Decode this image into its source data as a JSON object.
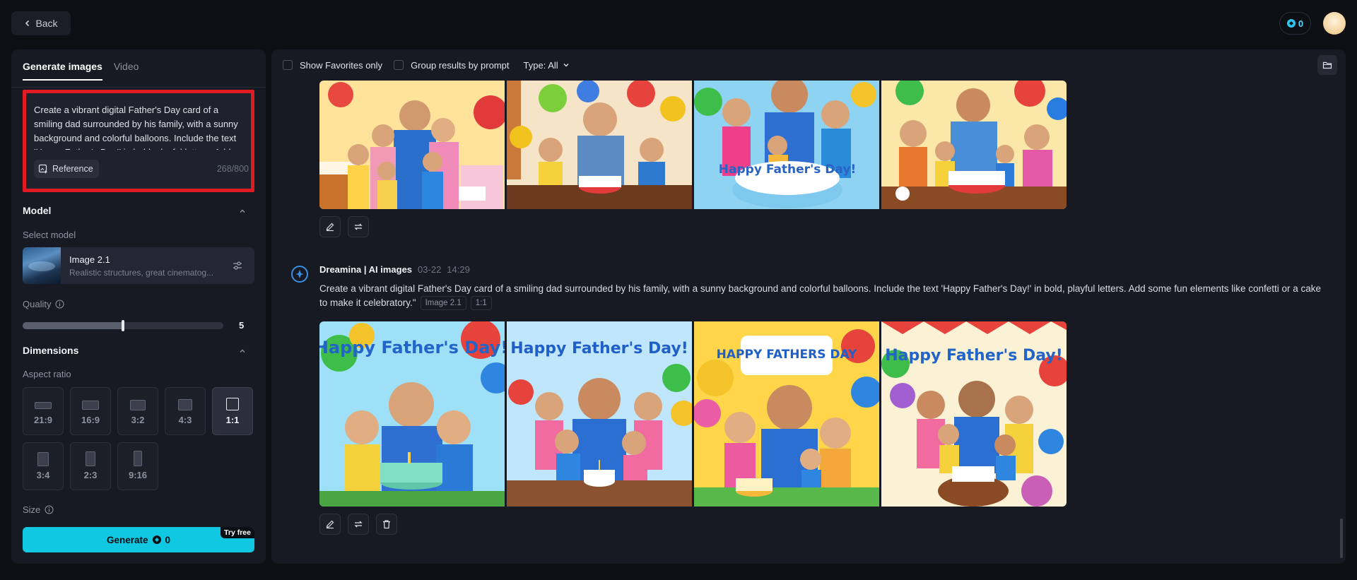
{
  "topbar": {
    "back_label": "Back",
    "credits": "0"
  },
  "left": {
    "tabs": [
      "Generate images",
      "Video"
    ],
    "prompt_text": "Create a vibrant digital Father's Day card of a smiling dad surrounded by his family, with a sunny background and colorful balloons. Include the text 'Happy Father's Day!' in bold, playful letters. Add some fun elements like confetti or a cake to make it celebratory.\"",
    "reference_label": "Reference",
    "char_count": "268/800",
    "model_section": "Model",
    "select_model_label": "Select model",
    "model_name": "Image 2.1",
    "model_desc": "Realistic structures, great cinematog...",
    "quality_label": "Quality",
    "quality_value": "5",
    "quality_fraction": 0.5,
    "dimensions_section": "Dimensions",
    "aspect_ratio_label": "Aspect ratio",
    "aspect_ratios": [
      "21:9",
      "16:9",
      "3:2",
      "4:3",
      "1:1",
      "3:4",
      "2:3",
      "9:16"
    ],
    "selected_ratio": "1:1",
    "size_label": "Size",
    "generate_label": "Generate",
    "generate_cost": "0",
    "try_free": "Try free"
  },
  "main": {
    "filters": {
      "favorites": "Show Favorites only",
      "group": "Group results by prompt",
      "type": "Type: All"
    },
    "result": {
      "author": "Dreamina | AI images",
      "date": "03-22",
      "time": "14:29",
      "prompt": "Create a vibrant digital Father's Day card of a smiling dad surrounded by his family, with a sunny background and colorful balloons. Include the text 'Happy Father's Day!' in bold, playful letters. Add some fun elements like confetti or a cake to make it celebratory.\"",
      "model_chip": "Image 2.1",
      "ratio_chip": "1:1"
    },
    "card_text": [
      "Happy Father's Day!",
      "Happy Father's Day!",
      "HAPPY FATHERS DAY",
      "Happy Father's Day!"
    ],
    "top_card_text": "Happy Father's Day!"
  },
  "colors": {
    "accent": "#11c8e3",
    "highlight": "#e01b24",
    "panel": "#171a22",
    "background": "#0d0f14"
  },
  "icons": [
    "chevron-left-icon",
    "credit-icon",
    "reference-icon",
    "settings-sliders-icon",
    "info-icon",
    "chevron-up-icon",
    "folder-icon",
    "edit-icon",
    "regenerate-icon",
    "trash-icon",
    "bot-icon"
  ]
}
